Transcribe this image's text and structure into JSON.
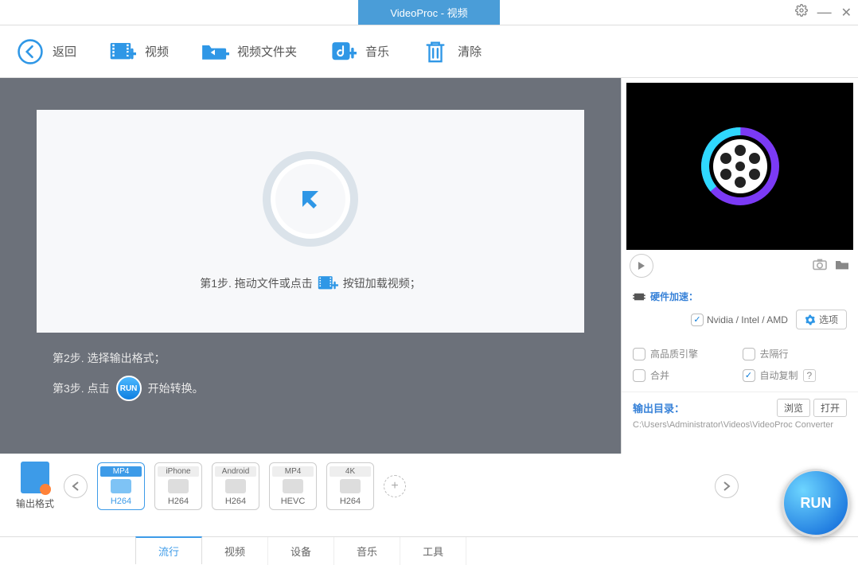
{
  "titlebar": {
    "title": "VideoProc - 视频"
  },
  "toolbar": {
    "back": "返回",
    "video": "视频",
    "folder": "视频文件夹",
    "music": "音乐",
    "clear": "清除"
  },
  "steps": {
    "step1a": "第1步. 拖动文件或点击",
    "step1b": "按钮加载视频；",
    "step2": "第2步. 选择输出格式；",
    "step3a": "第3步. 点击",
    "step3b": "开始转换。",
    "runBadge": "RUN"
  },
  "right": {
    "hwTitle": "硬件加速：",
    "gpu": "Nvidia / Intel / AMD",
    "options": "选项",
    "checks": {
      "hq": "高品质引擎",
      "deint": "去隔行",
      "merge": "合并",
      "autocopy": "自动复制",
      "help": "?"
    },
    "outputLabel": "输出目录：",
    "browse": "浏览",
    "open": "打开",
    "path": "C:\\Users\\Administrator\\Videos\\VideoProc Converter"
  },
  "formats": {
    "outputLabel": "输出格式",
    "cards": [
      {
        "top": "MP4",
        "bot": "H264",
        "active": true
      },
      {
        "top": "iPhone",
        "bot": "H264",
        "active": false
      },
      {
        "top": "Android",
        "bot": "H264",
        "active": false
      },
      {
        "top": "MP4",
        "bot": "HEVC",
        "active": false
      },
      {
        "top": "4K",
        "bot": "H264",
        "active": false
      }
    ],
    "plus": "+"
  },
  "tabs": {
    "items": [
      "流行",
      "视频",
      "设备",
      "音乐",
      "工具"
    ],
    "activeIndex": 0
  },
  "run": "RUN"
}
